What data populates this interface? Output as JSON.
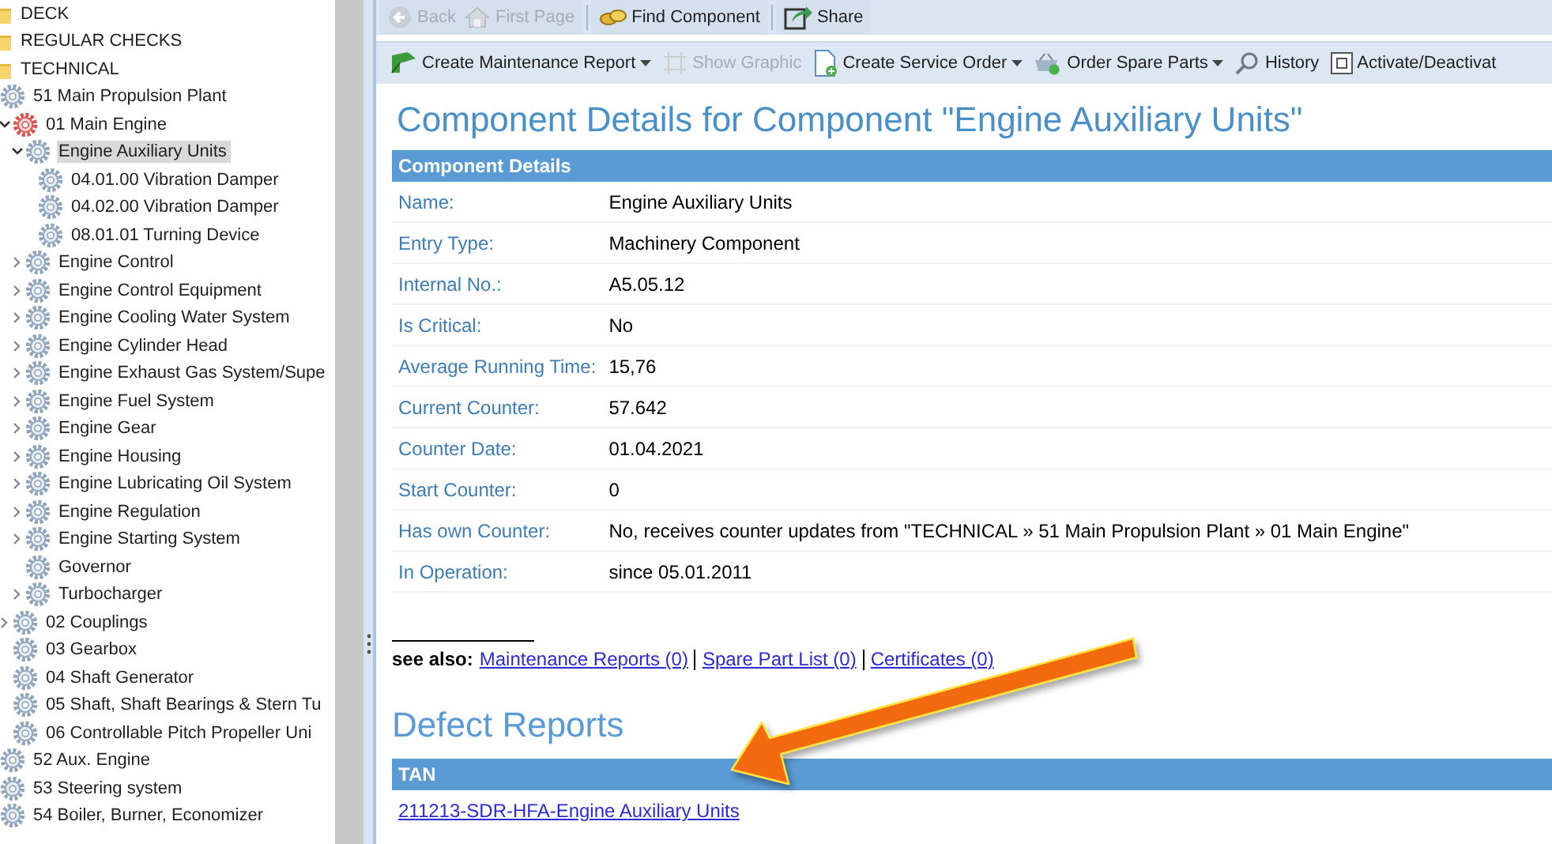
{
  "tree": [
    {
      "label": "DECK",
      "kind": "folder",
      "selected": false
    },
    {
      "label": "REGULAR CHECKS",
      "kind": "folder",
      "selected": false
    },
    {
      "label": "TECHNICAL",
      "kind": "folder",
      "selected": false,
      "children": [
        {
          "label": "51 Main Propulsion Plant",
          "kind": "gear",
          "selected": false,
          "children": [
            {
              "label": "01 Main Engine",
              "kind": "gear-alert",
              "selected": false,
              "expanded": true,
              "children": [
                {
                  "label": "Engine Auxiliary Units",
                  "kind": "gear",
                  "selected": true,
                  "expanded": true,
                  "children": [
                    {
                      "label": "04.01.00 Vibration Damper",
                      "kind": "gear",
                      "selected": false
                    },
                    {
                      "label": "04.02.00 Vibration Damper",
                      "kind": "gear",
                      "selected": false
                    },
                    {
                      "label": "08.01.01 Turning Device",
                      "kind": "gear",
                      "selected": false
                    }
                  ]
                },
                {
                  "label": "Engine Control",
                  "kind": "gear",
                  "selected": false,
                  "expanded": false
                },
                {
                  "label": "Engine Control Equipment",
                  "kind": "gear",
                  "selected": false,
                  "expanded": false
                },
                {
                  "label": "Engine Cooling Water System",
                  "kind": "gear",
                  "selected": false,
                  "expanded": false
                },
                {
                  "label": "Engine Cylinder Head",
                  "kind": "gear",
                  "selected": false,
                  "expanded": false
                },
                {
                  "label": "Engine Exhaust Gas System/Supe",
                  "kind": "gear",
                  "selected": false,
                  "expanded": false
                },
                {
                  "label": "Engine Fuel System",
                  "kind": "gear",
                  "selected": false,
                  "expanded": false
                },
                {
                  "label": "Engine Gear",
                  "kind": "gear",
                  "selected": false,
                  "expanded": false
                },
                {
                  "label": "Engine Housing",
                  "kind": "gear",
                  "selected": false,
                  "expanded": false
                },
                {
                  "label": "Engine Lubricating Oil System",
                  "kind": "gear",
                  "selected": false,
                  "expanded": false
                },
                {
                  "label": "Engine Regulation",
                  "kind": "gear",
                  "selected": false,
                  "expanded": false
                },
                {
                  "label": "Engine Starting System",
                  "kind": "gear",
                  "selected": false,
                  "expanded": false
                },
                {
                  "label": "Governor",
                  "kind": "gear",
                  "selected": false
                },
                {
                  "label": "Turbocharger",
                  "kind": "gear",
                  "selected": false,
                  "expanded": false
                }
              ]
            },
            {
              "label": "02 Couplings",
              "kind": "gear",
              "selected": false,
              "expanded": false
            },
            {
              "label": "03 Gearbox",
              "kind": "gear",
              "selected": false
            },
            {
              "label": "04 Shaft Generator",
              "kind": "gear",
              "selected": false
            },
            {
              "label": "05 Shaft, Shaft Bearings & Stern Tu",
              "kind": "gear",
              "selected": false
            },
            {
              "label": "06 Controllable Pitch Propeller Uni",
              "kind": "gear",
              "selected": false
            }
          ]
        },
        {
          "label": "52 Aux. Engine",
          "kind": "gear",
          "selected": false
        },
        {
          "label": "53 Steering system",
          "kind": "gear",
          "selected": false
        },
        {
          "label": "54 Boiler, Burner, Economizer",
          "kind": "gear",
          "selected": false
        }
      ]
    }
  ],
  "toolbar_1": [
    [
      {
        "label": "Back",
        "disabled": true,
        "dropdown": false
      },
      {
        "label": "First Page",
        "disabled": true,
        "dropdown": false
      }
    ],
    [
      {
        "label": "Find Component",
        "disabled": false,
        "dropdown": false
      }
    ],
    [
      {
        "label": "Share",
        "disabled": false,
        "dropdown": false
      }
    ]
  ],
  "toolbar_2": [
    {
      "label": "Create Maintenance Report",
      "disabled": false,
      "dropdown": true
    },
    {
      "label": "Show Graphic",
      "disabled": true,
      "dropdown": false
    },
    {
      "label": "Create Service Order",
      "disabled": false,
      "dropdown": true
    },
    {
      "label": "Order Spare Parts",
      "disabled": false,
      "dropdown": true
    },
    {
      "label": "History",
      "disabled": false,
      "dropdown": false
    },
    {
      "label": "Activate/Deactivat",
      "disabled": false,
      "dropdown": false
    }
  ],
  "title": "Component Details for Component \"Engine Auxiliary Units\"",
  "details": {
    "header": "Component Details",
    "rows": [
      {
        "label": "Name:",
        "value": "Engine Auxiliary Units"
      },
      {
        "label": "Entry Type:",
        "value": "Machinery Component"
      },
      {
        "label": "Internal No.:",
        "value": "A5.05.12"
      },
      {
        "label": "Is Critical:",
        "value": "No"
      },
      {
        "label": "Average Running Time:",
        "value": "15,76"
      },
      {
        "label": "Current Counter:",
        "value": "57.642"
      },
      {
        "label": "Counter Date:",
        "value": "01.04.2021"
      },
      {
        "label": "Start Counter:",
        "value": "0"
      },
      {
        "label": "Has own Counter:",
        "value": "No, receives counter updates from \"TECHNICAL » 51 Main Propulsion Plant » 01 Main Engine\""
      },
      {
        "label": "In Operation:",
        "value": "since 05.01.2011"
      }
    ]
  },
  "see_also": {
    "label": "see also:",
    "links": [
      "Maintenance Reports (0)",
      "Spare Part List (0)",
      "Certificates (0)"
    ]
  },
  "defect_reports": {
    "title": "Defect Reports",
    "columns": [
      "TAN"
    ],
    "rows": [
      [
        "211213-SDR-HFA-Engine Auxiliary Units"
      ]
    ]
  }
}
